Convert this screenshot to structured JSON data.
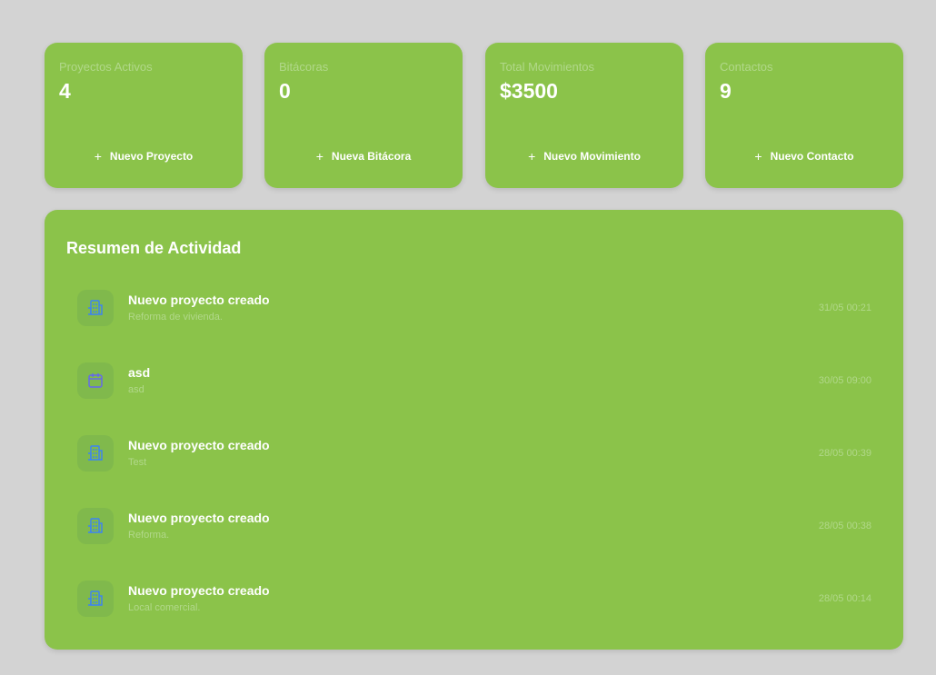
{
  "stats": [
    {
      "label": "Proyectos Activos",
      "value": "4",
      "action": "Nuevo Proyecto"
    },
    {
      "label": "Bitácoras",
      "value": "0",
      "action": "Nueva Bitácora"
    },
    {
      "label": "Total Movimientos",
      "value": "$3500",
      "action": "Nuevo Movimiento"
    },
    {
      "label": "Contactos",
      "value": "9",
      "action": "Nuevo Contacto"
    }
  ],
  "activity": {
    "title": "Resumen de Actividad",
    "items": [
      {
        "icon": "building-icon",
        "title": "Nuevo proyecto creado",
        "subtitle": "Reforma de vivienda.",
        "time": "31/05 00:21"
      },
      {
        "icon": "calendar-icon",
        "title": "asd",
        "subtitle": "asd",
        "time": "30/05 09:00"
      },
      {
        "icon": "building-icon",
        "title": "Nuevo proyecto creado",
        "subtitle": "Test",
        "time": "28/05 00:39"
      },
      {
        "icon": "building-icon",
        "title": "Nuevo proyecto creado",
        "subtitle": "Reforma.",
        "time": "28/05 00:38"
      },
      {
        "icon": "building-icon",
        "title": "Nuevo proyecto creado",
        "subtitle": "Local comercial.",
        "time": "28/05 00:14"
      }
    ]
  },
  "colors": {
    "background": "#d3d3d3",
    "card": "#8bc34a",
    "muted_text": "#b1d88a",
    "building_icon": "#3b82f6",
    "calendar_icon": "#6366f1"
  }
}
